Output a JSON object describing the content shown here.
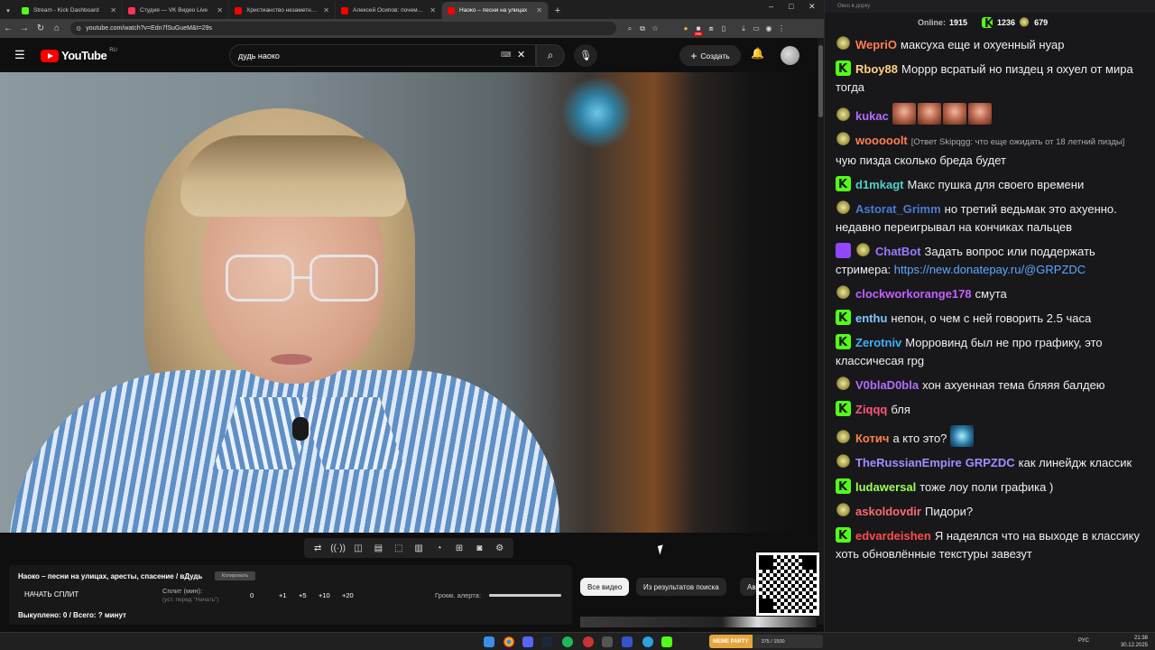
{
  "browser": {
    "tabs": [
      {
        "title": "Stream - Kick Dashboard",
        "color": "#53fc18"
      },
      {
        "title": "Студия — VK Видео Live",
        "color": "#ff3355"
      },
      {
        "title": "Христианство незаметно уход…",
        "color": "#ff0000"
      },
      {
        "title": "Алексей Осипов: почему Бог…",
        "color": "#ff0000"
      },
      {
        "title": "Наоко – песни на улицах",
        "color": "#ff0000",
        "active": true
      }
    ],
    "url": "youtube.com/watch?v=Edn7fSuGueM&t=29s",
    "badge_count": "395"
  },
  "youtube": {
    "logo": "YouTube",
    "region": "RU",
    "search_value": "дудь наоко",
    "create_label": "Создать"
  },
  "split": {
    "title": "Наоко – песни на улицах, аресты, спасение / вДудь",
    "copy_label": "Копировать",
    "start_label": "НАЧАТЬ СПЛИТ",
    "minutes_label": "Сплит (мин):",
    "minutes_hint": "(уст. перед \"Начать\")",
    "value": "0",
    "increments": [
      "+1",
      "+5",
      "+10",
      "+20"
    ],
    "alert_label": "Громк. алерта:",
    "alert_level": 1.0,
    "bought": "Выкуплено: 0 / Всего: ? минут"
  },
  "chips": [
    "Все видео",
    "Из результатов поиска",
    "Ав"
  ],
  "chat": {
    "window_title": "Окно в дорку",
    "online_label": "Online:",
    "online": "1915",
    "kick_count": "1236",
    "vk_count": "679",
    "messages": [
      {
        "badge": "vk",
        "user": "WepriO",
        "color": "#ff7f50",
        "text": "максуха еще и охуенный нуар"
      },
      {
        "badge": "kick",
        "user": "Rboy88",
        "color": "#ffd27f",
        "text": "Морpр всратый но пиздец я охуел от мира тогда"
      },
      {
        "badge": "vk",
        "user": "kukac",
        "color": "#b56bff",
        "text": "",
        "emotes": 4
      },
      {
        "badge": "vk",
        "user": "wooooolt",
        "color": "#ff7f50",
        "reply": "[Ответ Skipqgg: что еще ожидать от 18 летний пизды]",
        "text": "чую пизда сколько бреда будет"
      },
      {
        "badge": "kick",
        "user": "d1mkagt",
        "color": "#4fd1c5",
        "text": "Макс пушка для своего времени"
      },
      {
        "badge": "vk",
        "user": "Astorat_Grimm",
        "color": "#4a7bd0",
        "text": "но третий ведьмак это ахуенно. недавно переигрывал на кончиках пальцев"
      },
      {
        "badge": "bot",
        "user": "ChatBot",
        "color": "#9b7bff",
        "text": "Задать вопрос или поддержать стримера: ",
        "link": "https://new.donatepay.ru/@GRPZDC"
      },
      {
        "badge": "vk",
        "user": "clockworkorange178",
        "color": "#c061ff",
        "text": "смута"
      },
      {
        "badge": "kick",
        "user": "enthu",
        "color": "#7fc8ff",
        "text": "непон, о чем с ней говорить 2.5 часа"
      },
      {
        "badge": "kick",
        "user": "Zerotniv",
        "color": "#3fb0ff",
        "text": "Морровинд был не про графику, это классичесая rpg"
      },
      {
        "badge": "vk",
        "user": "V0blaD0bla",
        "color": "#b56bff",
        "text": "хон ахуенная тема бляяя балдею"
      },
      {
        "badge": "kick",
        "user": "Ziqqq",
        "color": "#ff5577",
        "text": "бля"
      },
      {
        "badge": "vk",
        "user": "Котич",
        "color": "#ff7f50",
        "text": "а кто это?",
        "emotes_blue": 1
      },
      {
        "badge": "vk",
        "user": "TheRussianEmpire",
        "color": "#a58cff",
        "mention": "GRPZDC",
        "text": "как линейдж классик"
      },
      {
        "badge": "kick",
        "user": "ludawersal",
        "color": "#9cff57",
        "text": "тоже лоу поли графика )"
      },
      {
        "badge": "vk",
        "user": "askoldovdir",
        "color": "#ff6a6a",
        "text": "Пидори?"
      },
      {
        "badge": "kick",
        "user": "edvardeishen",
        "color": "#ff4d4d",
        "text": "Я надеялся что на выходе в классику хоть обновлённые текстуры завезут"
      }
    ]
  },
  "taskbar": {
    "meme_label": "MEME PARTY",
    "meme_count": "375 / 1500",
    "lang": "РУС",
    "time": "21:38",
    "date": "30.12.2025"
  }
}
